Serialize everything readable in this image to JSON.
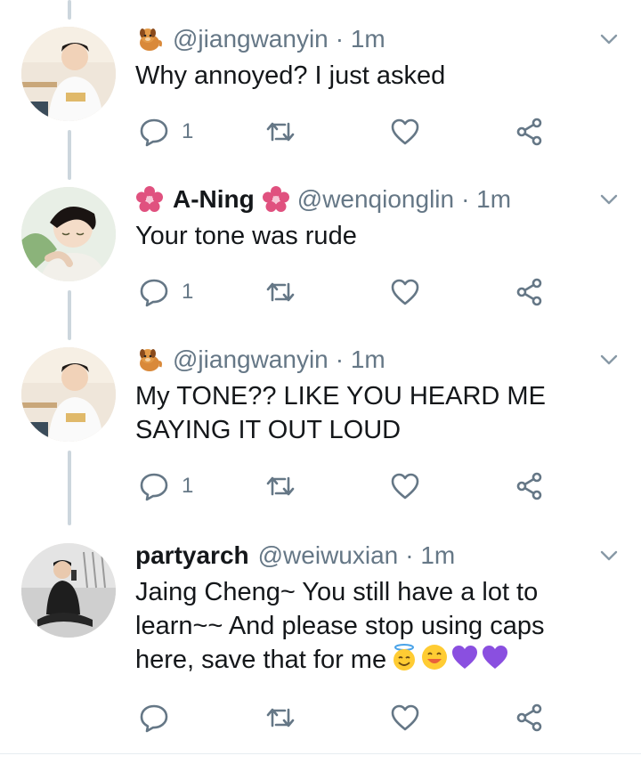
{
  "tweets": [
    {
      "emoji_before": "dog-emoji",
      "name": "",
      "emoji_after": "",
      "handle": "@jiangwanyin",
      "time": "· 1m",
      "text": "Why annoyed? I just asked",
      "replies": "1",
      "avatar": "jiangwanyin-avatar"
    },
    {
      "emoji_before": "cherry-blossom-emoji",
      "name": "A-Ning",
      "emoji_after": "cherry-blossom-emoji",
      "handle": "@wenqionglin",
      "time": "· 1m",
      "text": "Your tone was rude",
      "replies": "1",
      "avatar": "wenqionglin-avatar"
    },
    {
      "emoji_before": "dog-emoji",
      "name": "",
      "emoji_after": "",
      "handle": "@jiangwanyin",
      "time": "· 1m",
      "text": "My TONE?? LIKE YOU HEARD ME SAYING IT OUT LOUD",
      "replies": "1",
      "avatar": "jiangwanyin-avatar"
    },
    {
      "emoji_before": "",
      "name": "partyarch",
      "emoji_after": "",
      "handle": "@weiwuxian",
      "time": "· 1m",
      "text": "Jaing Cheng~ You still have a lot to learn~~ And please stop using caps here, save that for me",
      "replies": "",
      "trailing_emojis": [
        "halo-face-emoji",
        "smiling-face-emoji",
        "purple-heart-emoji",
        "purple-heart-emoji"
      ],
      "avatar": "weiwuxian-avatar"
    }
  ],
  "colors": {
    "text": "#14171a",
    "secondary": "#657786",
    "thread_line": "#ccd6dd",
    "purple_heart": "#8a4fe0",
    "blossom": "#e0517f"
  },
  "icons": [
    "reply-icon",
    "retweet-icon",
    "like-icon",
    "share-icon",
    "chevron-down-icon"
  ]
}
